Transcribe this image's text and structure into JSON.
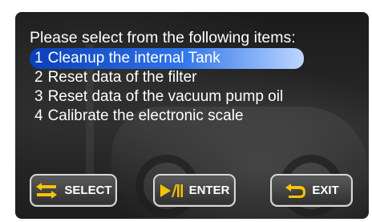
{
  "prompt": {
    "title": "Please select from the following items:"
  },
  "menu": {
    "items": [
      {
        "number": "1",
        "label": "Cleanup the internal Tank",
        "selected": true
      },
      {
        "number": "2",
        "label": "Reset data of the filter",
        "selected": false
      },
      {
        "number": "3",
        "label": "Reset data of the vacuum pump oil",
        "selected": false
      },
      {
        "number": "4",
        "label": "Calibrate the electronic scale",
        "selected": false
      }
    ]
  },
  "buttons": {
    "select": {
      "label": "SELECT",
      "icon": "swap-arrows-icon"
    },
    "enter": {
      "label": "ENTER",
      "icon": "play-pause-icon"
    },
    "exit": {
      "label": "EXIT",
      "icon": "return-arrow-icon"
    }
  },
  "colors": {
    "highlight_start": "#0a3fb8",
    "highlight_end": "#bcd6ff",
    "icon_yellow": "#f5c400",
    "text": "#ffffff"
  }
}
